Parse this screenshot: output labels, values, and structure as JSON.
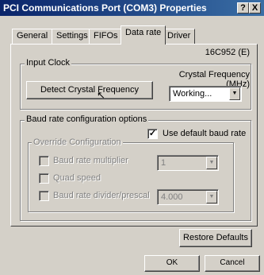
{
  "window": {
    "title": "PCI Communications Port (COM3) Properties",
    "help_glyph": "?",
    "close_glyph": "X"
  },
  "tabs": [
    {
      "label": "General"
    },
    {
      "label": "Settings"
    },
    {
      "label": "FIFOs"
    },
    {
      "label": "Data rate",
      "active": true
    },
    {
      "label": "Driver"
    }
  ],
  "chip_label": "16C952 (E)",
  "input_clock": {
    "legend": "Input Clock",
    "detect_button": "Detect Crystal Frequency",
    "crystal_label": "Crystal Frequency (MHz)",
    "crystal_value": "Working..."
  },
  "baud": {
    "legend": "Baud rate configuration options",
    "use_default_label": "Use default baud rate",
    "use_default_checked": true,
    "override": {
      "legend": "Override Configuration",
      "multiplier_label": "Baud rate multiplier",
      "multiplier_value": "1",
      "quad_speed_label": "Quad speed",
      "divider_label": "Baud rate divider/prescal",
      "divider_value": "4.000"
    }
  },
  "restore_defaults": "Restore Defaults",
  "ok": "OK",
  "cancel": "Cancel"
}
